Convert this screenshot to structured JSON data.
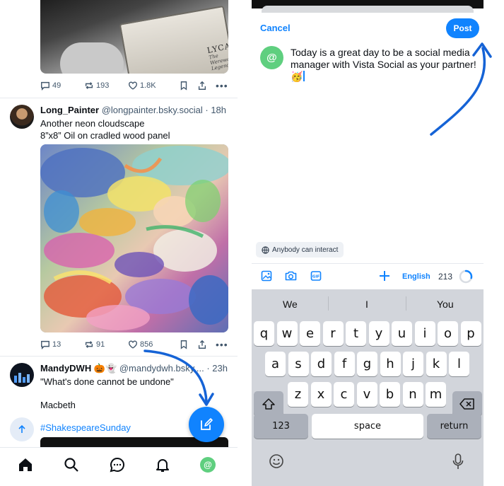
{
  "feed": {
    "post1": {
      "image_text_title": "LYCANTHROPY",
      "image_text_sub": "The Werewolf Legend",
      "actions": {
        "replies": "49",
        "reposts": "193",
        "likes": "1.8K"
      }
    },
    "post2": {
      "author": "Long_Painter",
      "handle": "@longpainter.bsky.social",
      "time": "· 18h",
      "text_line1": "Another neon cloudscape",
      "text_line2": "8”x8” Oil on cradled wood panel",
      "actions": {
        "replies": "13",
        "reposts": "91",
        "likes": "856"
      }
    },
    "post3": {
      "author": "MandyDWH",
      "emojis": "🎃👻",
      "handle": "@mandydwh.bsky....",
      "time": "· 23h",
      "text_line1": "\"What's done cannot be undone\"",
      "text_line2": "Macbeth",
      "hashtag": "#ShakespeareSunday"
    },
    "nav": [
      "home-icon",
      "search-icon",
      "chat-icon",
      "bell-icon",
      "profile-icon"
    ]
  },
  "composer": {
    "cancel_label": "Cancel",
    "post_label": "Post",
    "avatar_glyph": "@",
    "text": "Today is a great day to be a social media manager with Vista Social as your partner! 🥳",
    "interact_label": "Anybody can interact",
    "language": "English",
    "char_count": "213",
    "char_progress": 0.29
  },
  "keyboard": {
    "suggestions": [
      "We",
      "I",
      "You"
    ],
    "row1": [
      "q",
      "w",
      "e",
      "r",
      "t",
      "y",
      "u",
      "i",
      "o",
      "p"
    ],
    "row2": [
      "a",
      "s",
      "d",
      "f",
      "g",
      "h",
      "j",
      "k",
      "l"
    ],
    "row3": [
      "z",
      "x",
      "c",
      "v",
      "b",
      "n",
      "m"
    ],
    "numbers_label": "123",
    "space_label": "space",
    "return_label": "return"
  },
  "colors": {
    "accent": "#1083fe",
    "avatar_green": "#5fcf7f",
    "arrow": "#1563d6"
  }
}
